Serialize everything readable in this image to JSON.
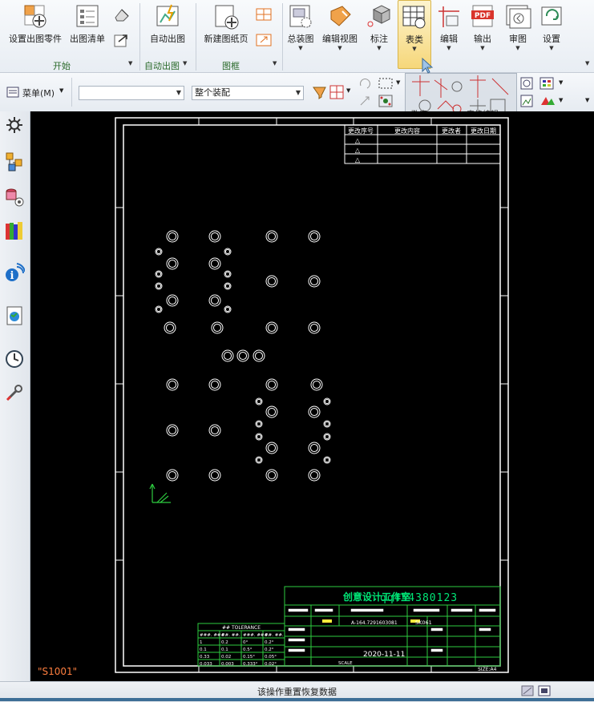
{
  "ribbon": {
    "buttons": [
      {
        "id": "set-part",
        "label": "设置出图零件",
        "icon": "set-part-icon"
      },
      {
        "id": "drawing-list",
        "label": "出图清单",
        "icon": "list-icon"
      },
      {
        "id": "auto-drawing",
        "label": "自动出图",
        "icon": "auto-drawing-icon"
      },
      {
        "id": "new-sheet",
        "label": "新建图纸页",
        "icon": "new-sheet-icon"
      },
      {
        "id": "assembly",
        "label": "总装图",
        "icon": "assembly-icon"
      },
      {
        "id": "edit-view",
        "label": "编辑视图",
        "icon": "edit-view-icon"
      },
      {
        "id": "annotate",
        "label": "标注",
        "icon": "annotate-icon"
      },
      {
        "id": "tables",
        "label": "表类",
        "icon": "table-icon"
      },
      {
        "id": "edit",
        "label": "编辑",
        "icon": "edit-icon"
      },
      {
        "id": "output",
        "label": "输出",
        "icon": "pdf-icon"
      },
      {
        "id": "review",
        "label": "审图",
        "icon": "review-icon"
      },
      {
        "id": "settings",
        "label": "设置",
        "icon": "settings-icon"
      }
    ],
    "groups": [
      {
        "label": "开始"
      },
      {
        "label": "自动出图"
      },
      {
        "label": "图框"
      }
    ]
  },
  "toolbar": {
    "menu_label": "菜单(M)",
    "combo_empty": "",
    "assembly_combo": "整个装配",
    "tooltip_overlay_1": "孔表",
    "tooltip_overlay_2": "表格编辑"
  },
  "drawing": {
    "revision_table": {
      "headers": [
        "更改序号",
        "更改内容",
        "更改者",
        "更改日期"
      ],
      "rows": [
        "△",
        "△",
        "△"
      ]
    },
    "tolerance_table": {
      "title": "## TOLERANCE",
      "headers": [
        "###. ###.",
        "##. ##.",
        "###. ###.",
        "##. ##."
      ],
      "rows": [
        [
          "1",
          "0.2",
          "0°",
          "0.2°"
        ],
        [
          "0.1",
          "0.1",
          "0.5°",
          "0.2°"
        ],
        [
          "0.33",
          "0.02",
          "0.15°",
          "0.05°"
        ],
        [
          "0.033",
          "0.003",
          "0.333°",
          "0.02°"
        ]
      ]
    },
    "title_block": {
      "studio": "创意设计工作室",
      "qq": "qq454380123",
      "part_no": "A-164.7291603081",
      "code": "SK061",
      "date": "2020-11-11",
      "size_label": "SIZE:A4",
      "scale_label": "SCALE"
    },
    "sheet_id": "\"S1001\""
  },
  "status": {
    "text": "该操作重置恢复数据"
  },
  "colors": {
    "canvas_bg": "#000000",
    "frame": "#ffffff",
    "title_green": "#00e676",
    "cad_cyan": "#00e5e5",
    "accent_orange": "#ff7f3f"
  }
}
